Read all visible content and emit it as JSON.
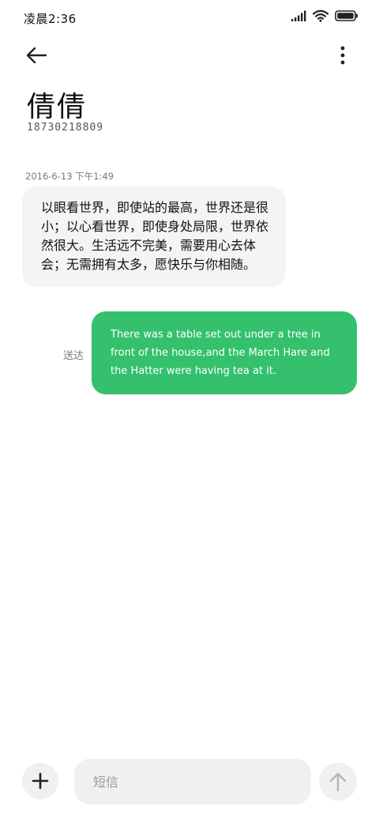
{
  "status_bar": {
    "time": "凌晨2:36"
  },
  "icons": {
    "back": "arrow-left-icon",
    "more": "more-vertical-icon",
    "add": "plus-icon",
    "send": "arrow-up-icon",
    "signal": "signal-icon",
    "wifi": "wifi-icon",
    "battery": "battery-icon"
  },
  "contact": {
    "name": "倩倩",
    "number": "18730218809"
  },
  "conversation": {
    "timestamp": "2016-6-13 下午1:49",
    "incoming_message": "以眼看世界，即使站的最高，世界还是很小；以心看世界，即使身处局限，世界依然很大。生活远不完美，需要用心去体会；无需拥有太多，愿快乐与你相随。",
    "outgoing_status": "送达",
    "outgoing_message": "There was a table set out under a tree in front of the house,and the March Hare and the Hatter were having tea at it."
  },
  "composer": {
    "placeholder": "短信"
  },
  "colors": {
    "outgoing_bubble": "#34c06c",
    "incoming_bubble": "#f4f4f4",
    "control_background": "#f0f0f0"
  }
}
